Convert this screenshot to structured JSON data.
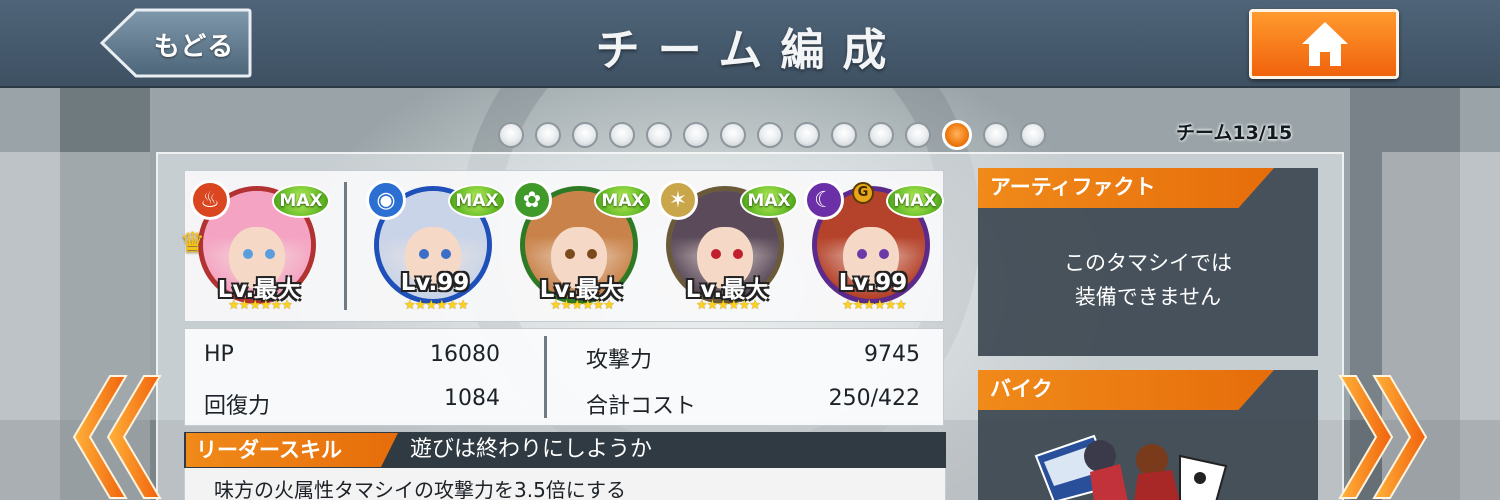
{
  "header": {
    "back_label": "もどる",
    "title": "チーム編成"
  },
  "pager": {
    "total": 15,
    "current": 13,
    "counter_text": "チーム13/15"
  },
  "team": [
    {
      "level": "Lv.最大",
      "max_badge": "MAX",
      "stars": "★★★★★★",
      "element": "fire",
      "leader": true,
      "hair": "#f4a3c2",
      "eye": "#5a9ee0",
      "frame": "#b23131"
    },
    {
      "level": "Lv.99",
      "max_badge": "MAX",
      "stars": "★★★★★★",
      "element": "water",
      "leader": false,
      "hair": "#c9d4e8",
      "eye": "#3b6ec9",
      "frame": "#1f4fb8"
    },
    {
      "level": "Lv.最大",
      "max_badge": "MAX",
      "stars": "★★★★★★",
      "element": "wood",
      "leader": false,
      "hair": "#c9834a",
      "eye": "#7a4a1c",
      "frame": "#2e7a24"
    },
    {
      "level": "Lv.最大",
      "max_badge": "MAX",
      "stars": "★★★★★★",
      "element": "light",
      "leader": false,
      "hair": "#5a4a5a",
      "eye": "#c21e2e",
      "frame": "#6a5a3a"
    },
    {
      "level": "Lv.99",
      "max_badge": "MAX",
      "stars": "★★★★★★",
      "element": "dark",
      "leader": false,
      "grade": "G",
      "hair": "#b5422a",
      "eye": "#6a3aa8",
      "frame": "#5b2a8a"
    }
  ],
  "stats": {
    "hp_label": "HP",
    "hp_value": "16080",
    "recovery_label": "回復力",
    "recovery_value": "1084",
    "attack_label": "攻撃力",
    "attack_value": "9745",
    "cost_label": "合計コスト",
    "cost_value": "250/422"
  },
  "leader_skill": {
    "tag": "リーダースキル",
    "name": "遊びは終わりにしようか",
    "description": "味方の火属性タマシイの攻撃力を3.5倍にする"
  },
  "artifact": {
    "title": "アーティファクト",
    "message_line1": "このタマシイでは",
    "message_line2": "装備できません"
  },
  "bike": {
    "title": "バイク"
  },
  "colors": {
    "accent_orange": "#f08a1a",
    "header_bg": "#4f6478",
    "panel_dark": "#34404a"
  }
}
